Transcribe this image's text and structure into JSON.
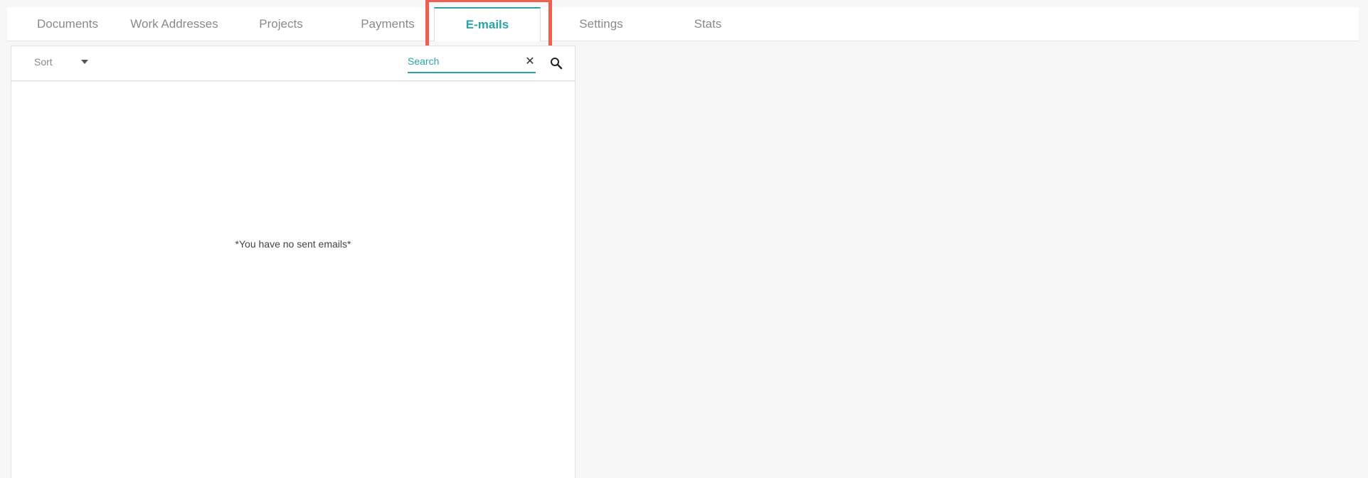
{
  "tabs": [
    {
      "label": "Documents"
    },
    {
      "label": "Work Addresses"
    },
    {
      "label": "Projects"
    },
    {
      "label": "Payments"
    },
    {
      "label": "E-mails",
      "active": true
    },
    {
      "label": "Settings"
    },
    {
      "label": "Stats"
    }
  ],
  "toolbar": {
    "sort_label": "Sort",
    "search_placeholder": "Search",
    "search_value": "",
    "clear_symbol": "✕"
  },
  "main": {
    "empty_message": "*You have no sent emails*"
  },
  "colors": {
    "accent": "#2aa3a8",
    "highlight": "#ef5e4e"
  },
  "icons": {
    "search": "search-icon",
    "clear": "close-icon",
    "sort_caret": "caret-down-icon"
  }
}
